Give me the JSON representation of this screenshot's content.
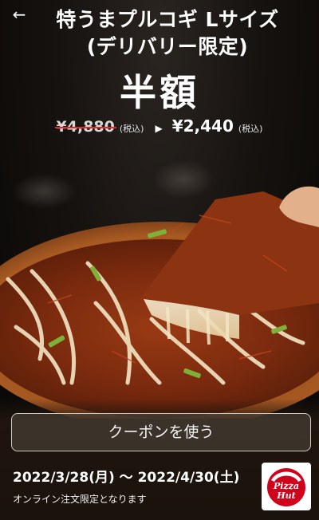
{
  "header": {
    "back_icon": "arrow-left-icon",
    "title_line1": "特うまプルコギ Lサイズ",
    "title_line2": "(デリバリー限定)"
  },
  "offer": {
    "headline": "半額",
    "old_price": "¥4,880",
    "old_tax": "(税込)",
    "arrow": "▶",
    "new_price": "¥2,440",
    "new_tax": "(税込)"
  },
  "coupon": {
    "button_label": "クーポンを使う"
  },
  "footer": {
    "period": "2022/3/28(月) 〜 2022/4/30(土)",
    "note": "オンライン注文限定となります"
  },
  "logo": {
    "text_line1": "Pizza",
    "text_line2": "Hut"
  },
  "colors": {
    "accent_red": "#e02b2b",
    "logo_red": "#d0021b"
  }
}
